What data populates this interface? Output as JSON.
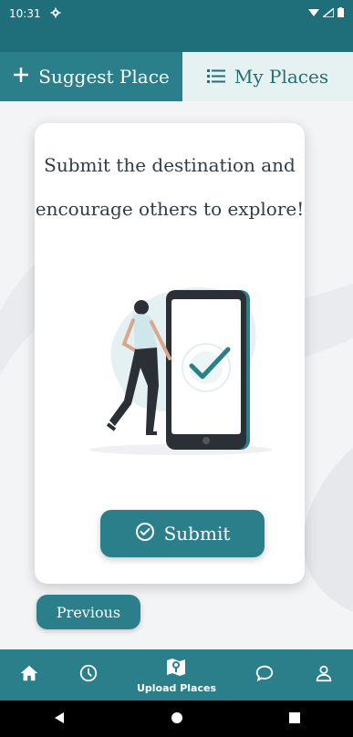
{
  "status_bar": {
    "time": "10:31"
  },
  "tabs": {
    "suggest_label": "Suggest Place",
    "my_places_label": "My Places"
  },
  "card": {
    "line1": "Submit the destination and",
    "line2": "encourage others to explore!"
  },
  "buttons": {
    "submit_label": "Submit",
    "previous_label": "Previous"
  },
  "bottom_nav": {
    "items": [
      {
        "icon": "home-icon",
        "label": ""
      },
      {
        "icon": "history-icon",
        "label": ""
      },
      {
        "icon": "map-pin-icon",
        "label": "Upload Places"
      },
      {
        "icon": "chat-icon",
        "label": ""
      },
      {
        "icon": "profile-icon",
        "label": ""
      }
    ]
  },
  "colors": {
    "primary": "#2a7f8a",
    "primary_dark": "#1f6f7a",
    "tab_inactive_bg": "#e6f1f1",
    "text_dark": "#2f3d4a"
  }
}
